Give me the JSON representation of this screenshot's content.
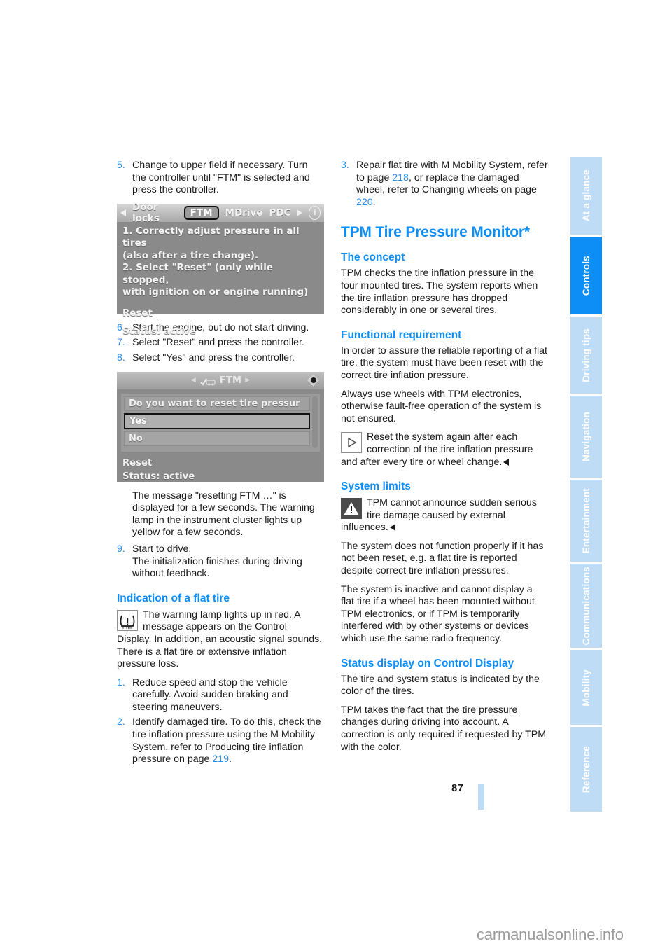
{
  "page": {
    "number": "87",
    "watermark": "carmanualsonline.info"
  },
  "sidetabs": [
    {
      "label": "At a glance",
      "active": false
    },
    {
      "label": "Controls",
      "active": true
    },
    {
      "label": "Driving tips",
      "active": false
    },
    {
      "label": "Navigation",
      "active": false
    },
    {
      "label": "Entertainment",
      "active": false
    },
    {
      "label": "Communications",
      "active": false
    },
    {
      "label": "Mobility",
      "active": false
    },
    {
      "label": "Reference",
      "active": false
    }
  ],
  "left_column": {
    "step5": {
      "num": "5.",
      "text": "Change to upper field if necessary. Turn the controller until \"FTM\" is selected and press the controller."
    },
    "screenshot1": {
      "menu": {
        "left_arrow": "left-arrow",
        "items": [
          "Door locks",
          "FTM",
          "MDrive",
          "PDC"
        ],
        "selected": "FTM",
        "right_arrow": "right-arrow",
        "info": "i"
      },
      "lines": [
        "1. Correctly adjust pressure in all tires",
        "(also after a tire change).",
        "2. Select \"Reset\" (only while stopped,",
        "with ignition on or engine running)"
      ],
      "reset": "Reset",
      "status": "Status: active"
    },
    "step6": {
      "num": "6.",
      "text": "Start the engine, but do not start driving."
    },
    "step7": {
      "num": "7.",
      "text": "Select \"Reset\" and press the controller."
    },
    "step8": {
      "num": "8.",
      "text": "Select \"Yes\" and press the controller."
    },
    "screenshot2": {
      "title": "FTM",
      "question": "Do you want to reset tire pressur",
      "option_yes": "Yes",
      "option_no": "No",
      "reset": "Reset",
      "status": "Status:  active"
    },
    "note_after_shot2": "The message \"resetting FTM …\" is displayed for a few seconds. The warning lamp in the instrument cluster lights up yellow for a few seconds.",
    "step9": {
      "num": "9.",
      "text": "Start to drive.",
      "sub": "The initialization finishes during driving without feedback."
    },
    "heading_flat_tire": "Indication of a flat tire",
    "flat_tire_note_icon": "tire-pressure-warning-icon",
    "flat_tire_note": "The warning lamp lights up in red. A message appears on the Control Display. In addition, an acoustic signal sounds. There is a flat tire or extensive inflation pressure loss.",
    "item1": {
      "num": "1.",
      "text": "Reduce speed and stop the vehicle carefully. Avoid sudden braking and steering maneuvers."
    },
    "item2": {
      "num": "2.",
      "text_before": "Identify damaged tire. To do this, check the tire inflation pressure using the M Mobility System, refer to Producing tire inflation pressure on page ",
      "page_ref": "219",
      "text_after": "."
    }
  },
  "right_column": {
    "item3": {
      "num": "3.",
      "text_a": "Repair flat tire with M Mobility System, refer to page ",
      "ref_a": "218",
      "text_b": ", or replace the damaged wheel, refer to Changing wheels on page ",
      "ref_b": "220",
      "text_c": "."
    },
    "heading_main": "TPM Tire Pressure Monitor*",
    "heading_concept": "The concept",
    "concept_text": "TPM checks the tire inflation pressure in the four mounted tires. The system reports when the tire inflation pressure has dropped considerably in one or several tires.",
    "heading_functional": "Functional requirement",
    "functional_p1": "In order to assure the reliable reporting of a flat tire, the system must have been reset with the correct tire inflation pressure.",
    "functional_p2": "Always use wheels with TPM electronics, otherwise fault-free operation of the system is not ensured.",
    "functional_note_icon": "play-triangle-icon",
    "functional_note": "Reset the system again after each correction of the tire inflation pressure and after every tire or wheel change.",
    "heading_limits": "System limits",
    "limits_note_icon": "warning-triangle-icon",
    "limits_note": "TPM cannot announce sudden serious tire damage caused by external influences.",
    "limits_p1": "The system does not function properly if it has not been reset, e.g. a flat tire is reported despite correct tire inflation pressures.",
    "limits_p2": "The system is inactive and cannot display a flat tire if a wheel has been mounted without TPM electronics, or if TPM is temporarily interfered with by other systems or devices which use the same radio frequency.",
    "heading_status": "Status display on Control Display",
    "status_p1": "The tire and system status is indicated by the color of the tires.",
    "status_p2": "TPM takes the fact that the tire pressure changes during driving into account. A correction is only required if requested by TPM with the color."
  },
  "colors": {
    "accent_blue": "#0d8ef7",
    "tab_inactive": "#bfdcf7",
    "ref_link": "#2a8fe8",
    "text": "#1a1a1a"
  }
}
